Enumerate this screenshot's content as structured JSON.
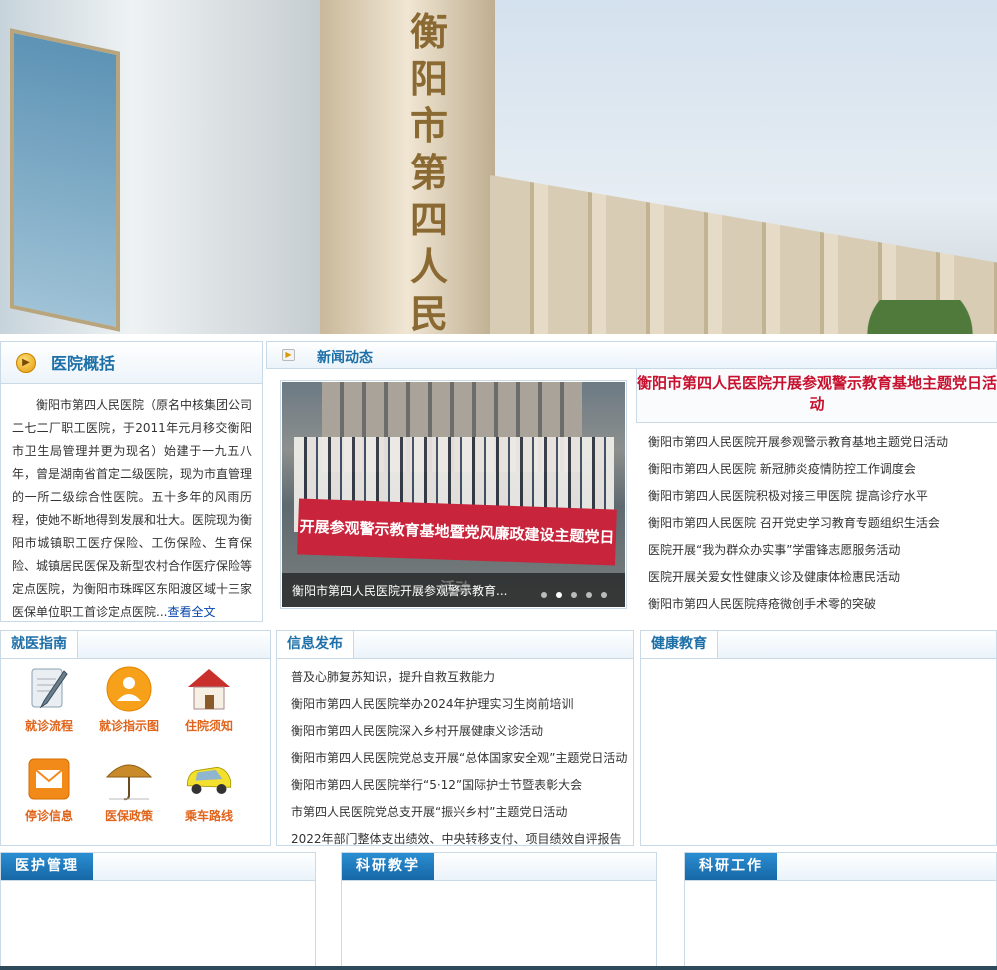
{
  "banner": {
    "sign_text": "衡阳市第四人民医院"
  },
  "overview": {
    "title": "医院概括",
    "text": "衡阳市第四人民医院（原名中核集团公司二七二厂职工医院，于2011年元月移交衡阳市卫生局管理并更为现名）始建于一九五八年，曾是湖南省首定二级医院，现为市直管理的一所二级综合性医院。五十多年的风雨历程，使她不断地得到发展和壮大。医院现为衡阳市城镇职工医疗保险、工伤保险、生育保险、城镇居民医保及新型农村合作医疗保险等定点医院，为衡阳市珠晖区东阳渡区域十三家医保单位职工首诊定点医院...",
    "more": "查看全文"
  },
  "news": {
    "title": "新闻动态",
    "slide_caption": "衡阳市第四人民医院开展参观警示教育...",
    "slide_banner": "开展参观警示教育基地暨党风廉政建设主题党日活动",
    "headline": "衡阳市第四人民医院开展参观警示教育基地主题党日活动",
    "items": [
      "衡阳市第四人民医院开展参观警示教育基地主题党日活动",
      "衡阳市第四人民医院 新冠肺炎疫情防控工作调度会",
      "衡阳市第四人民医院积极对接三甲医院 提高诊疗水平",
      "衡阳市第四人民医院 召开党史学习教育专题组织生活会",
      "医院开展“我为群众办实事”学雷锋志愿服务活动",
      "医院开展关爱女性健康义诊及健康体检惠民活动",
      "衡阳市第四人民医院痔疮微创手术零的突破"
    ]
  },
  "guide": {
    "title": "就医指南",
    "items": [
      {
        "label": "就诊流程",
        "icon": "pen-paper-icon"
      },
      {
        "label": "就诊指示图",
        "icon": "person-badge-icon"
      },
      {
        "label": "住院须知",
        "icon": "house-icon"
      },
      {
        "label": "停诊信息",
        "icon": "envelope-icon"
      },
      {
        "label": "医保政策",
        "icon": "umbrella-icon"
      },
      {
        "label": "乘车路线",
        "icon": "car-icon"
      }
    ]
  },
  "info": {
    "title": "信息发布",
    "items": [
      "普及心肺复苏知识，提升自救互救能力",
      "衡阳市第四人民医院举办2024年护理实习生岗前培训",
      "衡阳市第四人民医院深入乡村开展健康义诊活动",
      "衡阳市第四人民医院党总支开展“总体国家安全观”主题党日活动",
      "衡阳市第四人民医院举行“5·12”国际护士节暨表彰大会",
      "市第四人民医院党总支开展“振兴乡村”主题党日活动",
      "2022年部门整体支出绩效、中央转移支付、项目绩效自评报告"
    ]
  },
  "health": {
    "title": "健康教育"
  },
  "care": {
    "title": "医护管理"
  },
  "teach": {
    "title": "科研教学"
  },
  "research": {
    "title": "科研工作"
  }
}
